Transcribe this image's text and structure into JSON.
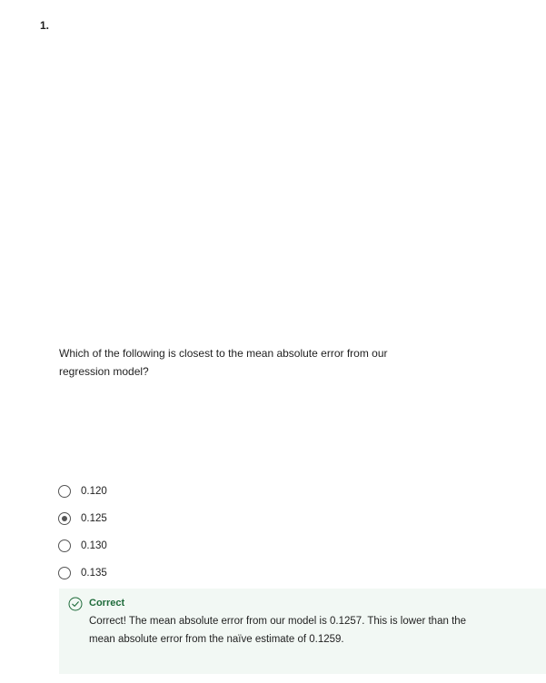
{
  "question": {
    "number": "1.",
    "text": "Which of the following is closest to the mean absolute error from our regression model?"
  },
  "options": [
    {
      "label": "0.120",
      "selected": false
    },
    {
      "label": "0.125",
      "selected": true
    },
    {
      "label": "0.130",
      "selected": false
    },
    {
      "label": "0.135",
      "selected": false
    }
  ],
  "feedback": {
    "status": "Correct",
    "message": "Correct! The mean absolute error from our model is 0.1257. This is lower than the mean absolute error from the naïve estimate of 0.1259.",
    "icon": "check-circle-icon",
    "color": "#1e6b3a",
    "background": "#f2f8f4"
  }
}
